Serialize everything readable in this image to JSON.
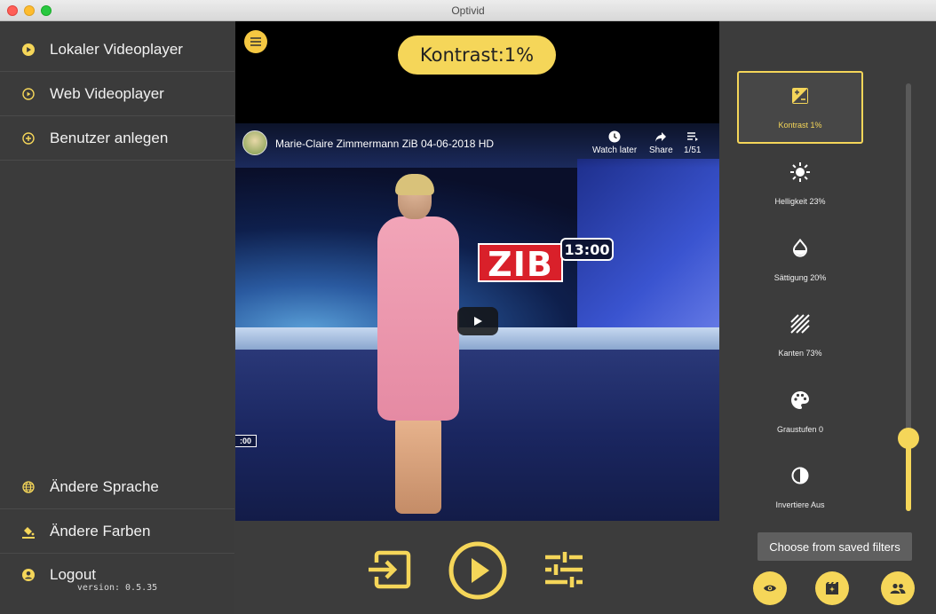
{
  "window": {
    "title": "Optivid"
  },
  "sidebar": {
    "items": [
      {
        "label": "Lokaler Videoplayer",
        "icon": "play-circle-filled-icon"
      },
      {
        "label": "Web Videoplayer",
        "icon": "play-circle-outline-icon"
      },
      {
        "label": "Benutzer anlegen",
        "icon": "add-circle-outline-icon"
      }
    ],
    "bottom_items": [
      {
        "label": "Ändere Sprache",
        "icon": "globe-icon"
      },
      {
        "label": "Ändere Farben",
        "icon": "paint-bucket-icon"
      },
      {
        "label": "Logout",
        "icon": "account-circle-icon"
      }
    ],
    "version": "version: 0.5.35"
  },
  "main": {
    "contrast_label": "Kontrast:1%",
    "video": {
      "title": "Marie-Claire Zimmermann ZiB 04-06-2018 HD",
      "watch_later": "Watch later",
      "share": "Share",
      "playlist_count": "1/51",
      "logo_text": "ZIB",
      "logo_time": "13:00",
      "side_tag": ":00"
    }
  },
  "filters": {
    "items": [
      {
        "label": "Kontrast 1%",
        "icon": "contrast-adjust-icon",
        "active": true
      },
      {
        "label": "Helligkeit 23%",
        "icon": "brightness-icon",
        "active": false
      },
      {
        "label": "Sättigung 20%",
        "icon": "saturation-drop-icon",
        "active": false
      },
      {
        "label": "Kanten 73%",
        "icon": "edges-hatch-icon",
        "active": false
      },
      {
        "label": "Graustufen 0",
        "icon": "palette-icon",
        "active": false
      },
      {
        "label": "Invertiere Aus",
        "icon": "invert-icon",
        "active": false
      }
    ],
    "slider_level": 0.17,
    "tooltip": "Choose from saved filters"
  },
  "colors": {
    "accent": "#f5d659",
    "sidebar_bg": "#3b3b3b",
    "panel_bg": "#3c3c3c"
  }
}
